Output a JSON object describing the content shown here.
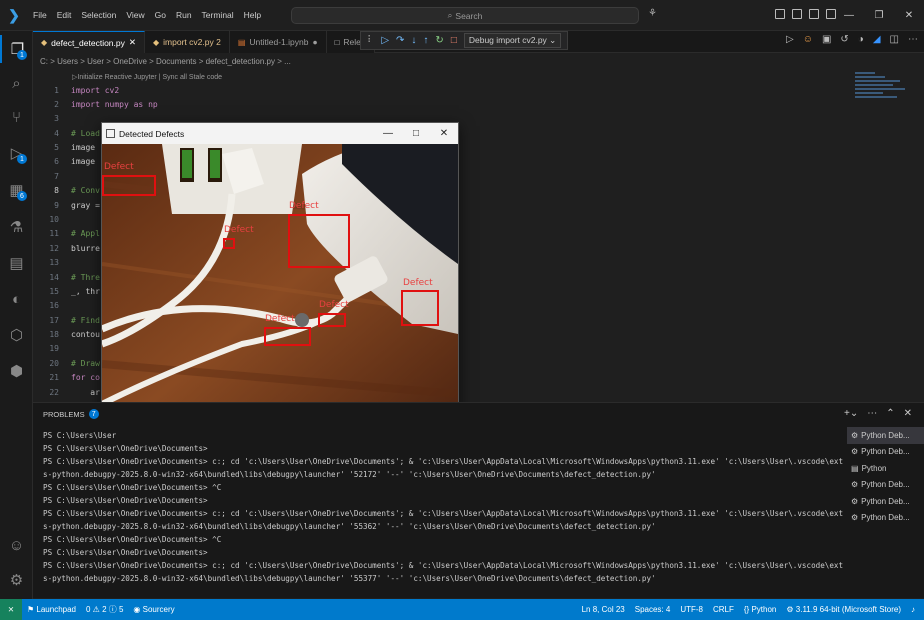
{
  "menu": [
    "File",
    "Edit",
    "Selection",
    "View",
    "Go",
    "Run",
    "Terminal",
    "Help"
  ],
  "search_label": "Search",
  "tabs": [
    {
      "label": "defect_detection.py",
      "active": true
    },
    {
      "label": "import cv2.py 2",
      "active": false
    },
    {
      "label": "Untitled-1.ipynb",
      "active": false
    },
    {
      "label": "Relea",
      "active": false
    }
  ],
  "debug_config": "Debug import cv2.py",
  "breadcrumb": "C: > Users > User > OneDrive > Documents > defect_detection.py > ...",
  "codelens": "Initialize Reactive Jupyter | Sync all Stale code",
  "code_lines": [
    {
      "n": "1",
      "text": "import cv2"
    },
    {
      "n": "2",
      "text": "import numpy as np"
    },
    {
      "n": "3",
      "text": ""
    },
    {
      "n": "4",
      "text": "# Load"
    },
    {
      "n": "5",
      "text": "image"
    },
    {
      "n": "6",
      "text": "image"
    },
    {
      "n": "7",
      "text": ""
    },
    {
      "n": "8",
      "text": "# Conv"
    },
    {
      "n": "9",
      "text": "gray ="
    },
    {
      "n": "10",
      "text": ""
    },
    {
      "n": "11",
      "text": "# Appl"
    },
    {
      "n": "12",
      "text": "blurre"
    },
    {
      "n": "13",
      "text": ""
    },
    {
      "n": "14",
      "text": "# Thre"
    },
    {
      "n": "15",
      "text": "_, thr"
    },
    {
      "n": "16",
      "text": ""
    },
    {
      "n": "17",
      "text": "# Find"
    },
    {
      "n": "18",
      "text": "contou"
    },
    {
      "n": "19",
      "text": ""
    },
    {
      "n": "20",
      "text": "# Draw"
    },
    {
      "n": "21",
      "text": "for co"
    },
    {
      "n": "22",
      "text": "    ar"
    }
  ],
  "window": {
    "title": "Detected Defects",
    "defect_label": "Defect"
  },
  "panel": {
    "tab": "PROBLEMS",
    "badge": "7"
  },
  "terminal_lines": [
    "PS C:\\Users\\User",
    "PS C:\\Users\\User\\OneDrive\\Documents>",
    "PS C:\\Users\\User\\OneDrive\\Documents> c:; cd 'c:\\Users\\User\\OneDrive\\Documents'; & 'c:\\Users\\User\\AppData\\Local\\Microsoft\\WindowsApps\\python3.11.exe' 'c:\\Users\\User\\.vscode\\extensions\\m",
    "s-python.debugpy-2025.8.0-win32-x64\\bundled\\libs\\debugpy\\launcher' '52172' '--' 'c:\\Users\\User\\OneDrive\\Documents\\defect_detection.py'",
    "PS C:\\Users\\User\\OneDrive\\Documents> ^C",
    "PS C:\\Users\\User\\OneDrive\\Documents>",
    "PS C:\\Users\\User\\OneDrive\\Documents> c:; cd 'c:\\Users\\User\\OneDrive\\Documents'; & 'c:\\Users\\User\\AppData\\Local\\Microsoft\\WindowsApps\\python3.11.exe' 'c:\\Users\\User\\.vscode\\extensions\\m",
    "s-python.debugpy-2025.8.0-win32-x64\\bundled\\libs\\debugpy\\launcher' '55362' '--' 'c:\\Users\\User\\OneDrive\\Documents\\defect_detection.py'",
    "PS C:\\Users\\User\\OneDrive\\Documents> ^C",
    "PS C:\\Users\\User\\OneDrive\\Documents>",
    "PS C:\\Users\\User\\OneDrive\\Documents> c:; cd 'c:\\Users\\User\\OneDrive\\Documents'; & 'c:\\Users\\User\\AppData\\Local\\Microsoft\\WindowsApps\\python3.11.exe' 'c:\\Users\\User\\.vscode\\extensions\\m",
    "s-python.debugpy-2025.8.0-win32-x64\\bundled\\libs\\debugpy\\launcher' '55377' '--' 'c:\\Users\\User\\OneDrive\\Documents\\defect_detection.py'"
  ],
  "terminal_list": [
    "Python Deb...",
    "Python Deb...",
    "Python",
    "Python Deb...",
    "Python Deb...",
    "Python Deb..."
  ],
  "status": {
    "launchpad": "Launchpad",
    "problems": "0 ⚠ 2 ⓘ 5",
    "sourcery": "Sourcery",
    "position": "Ln 8, Col 23",
    "spaces": "Spaces: 4",
    "encoding": "UTF-8",
    "eol": "CRLF",
    "language": "Python",
    "interpreter": "3.11.9 64-bit (Microsoft Store)"
  },
  "colors": {
    "accent": "#0078d4",
    "statusbar": "#007acc",
    "defect_box": "#e01010"
  }
}
